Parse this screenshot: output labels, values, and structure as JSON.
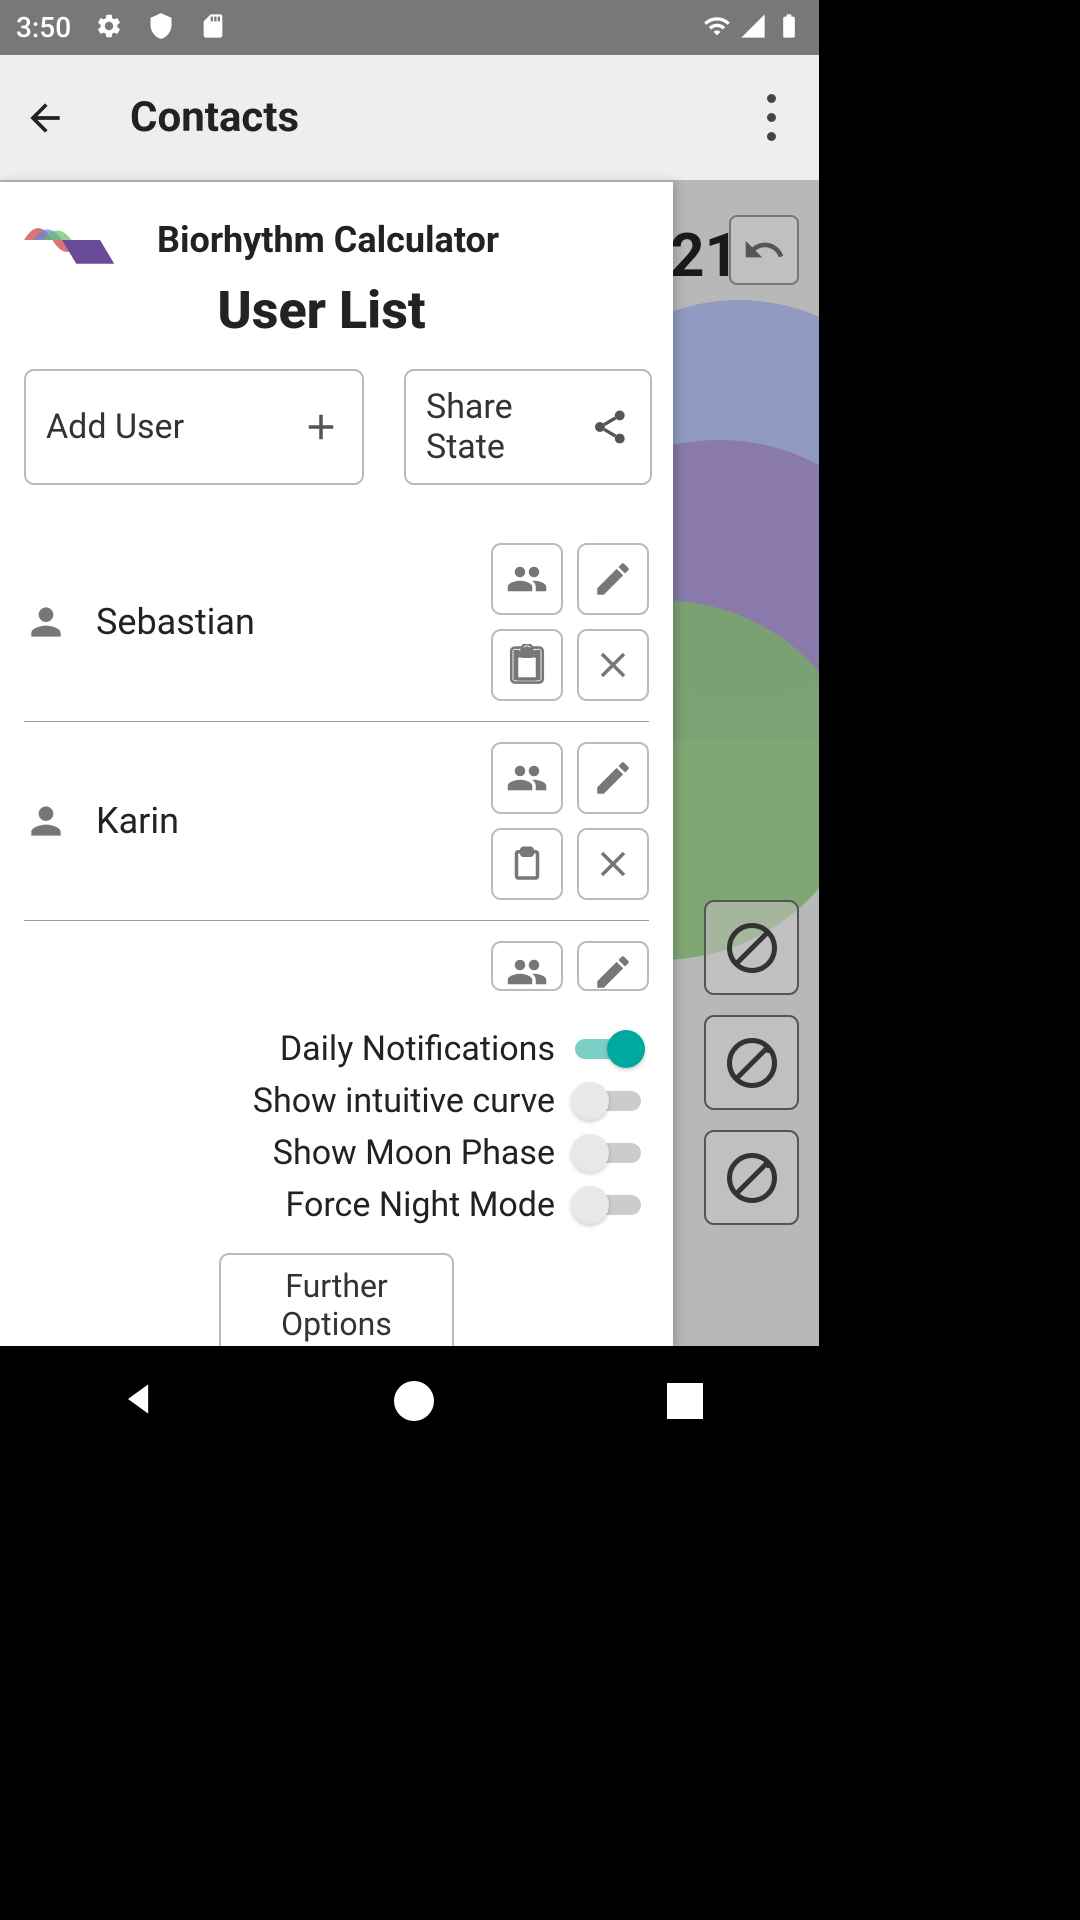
{
  "status": {
    "time": "3:50"
  },
  "app": {
    "title": "Contacts"
  },
  "bg": {
    "date": "21"
  },
  "drawer": {
    "title": "Biorhythm Calculator",
    "subtitle": "User List",
    "add_user": "Add User",
    "share_state": "Share State",
    "further": "Further Options"
  },
  "users": [
    {
      "name": "Sebastian"
    },
    {
      "name": "Karin"
    }
  ],
  "toggles": [
    {
      "label": "Daily Notifications",
      "on": true
    },
    {
      "label": "Show intuitive curve",
      "on": false
    },
    {
      "label": "Show Moon Phase",
      "on": false
    },
    {
      "label": "Force Night Mode",
      "on": false
    }
  ]
}
